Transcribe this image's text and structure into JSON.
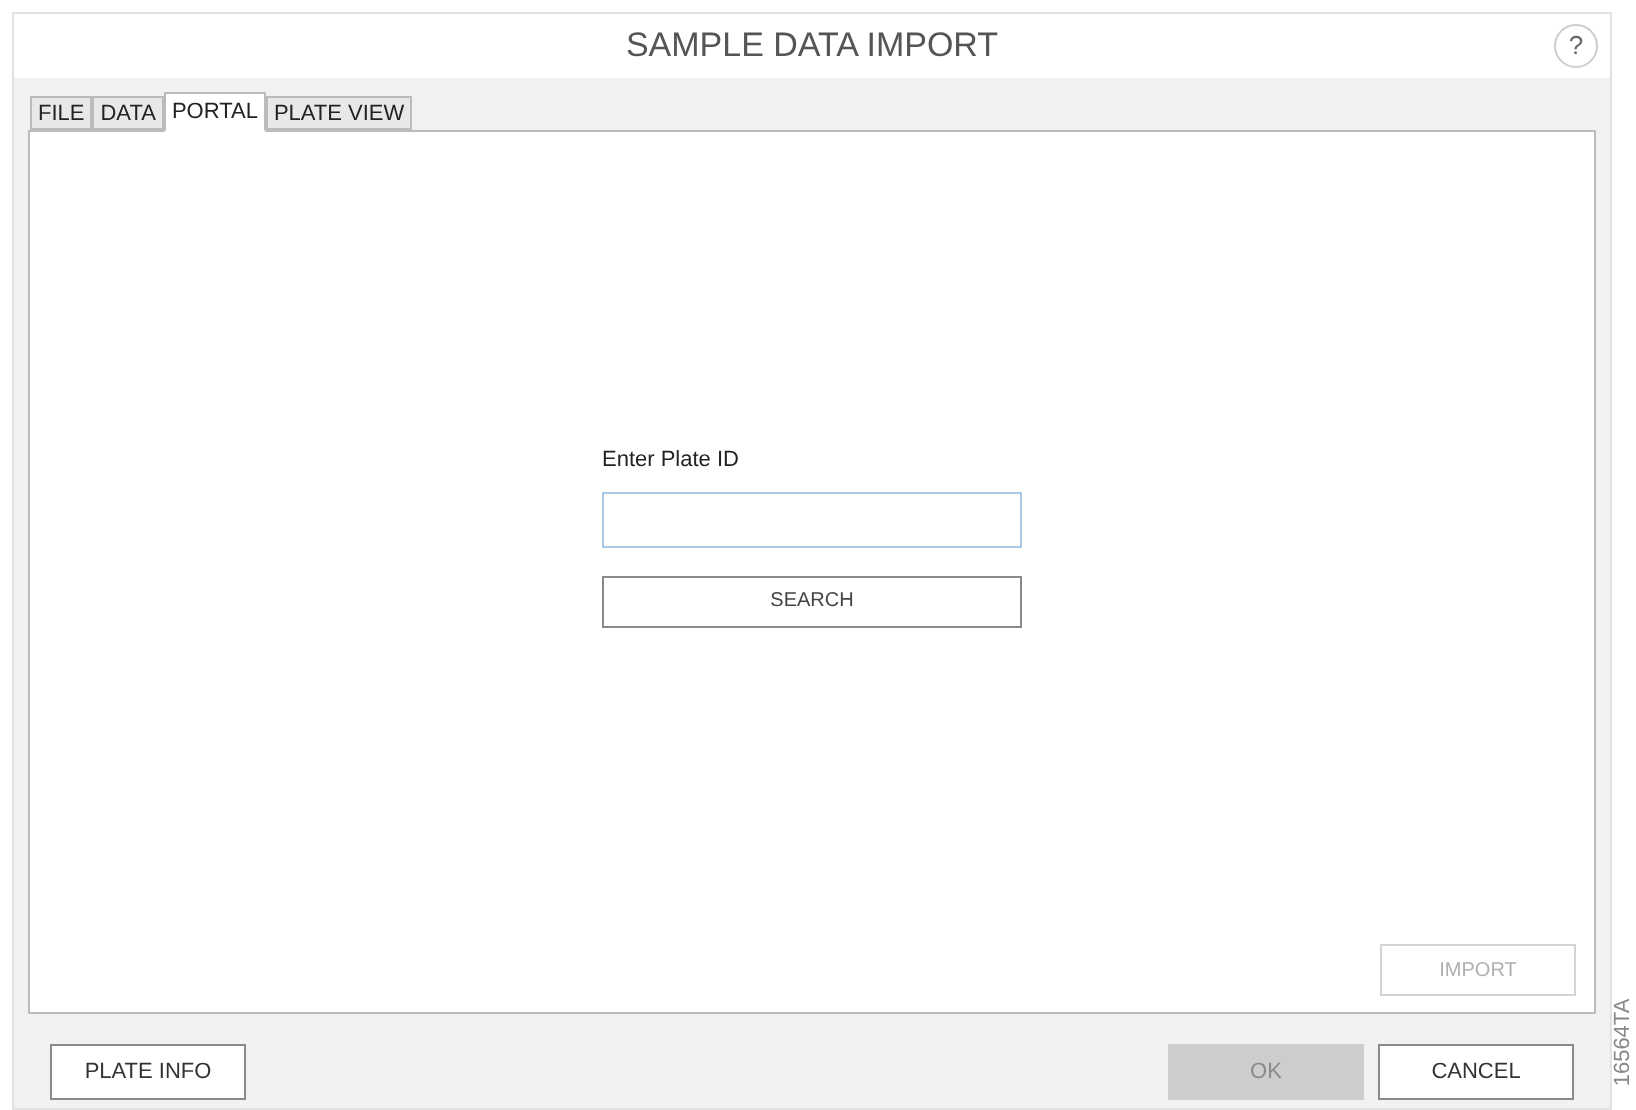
{
  "window": {
    "title": "SAMPLE DATA IMPORT",
    "help": "?"
  },
  "tabs": [
    {
      "label": "FILE",
      "selected": false
    },
    {
      "label": "DATA",
      "selected": false
    },
    {
      "label": "PORTAL",
      "selected": true
    },
    {
      "label": "PLATE VIEW",
      "selected": false
    }
  ],
  "portal": {
    "field_label": "Enter Plate ID",
    "search_button": "SEARCH",
    "import_button": {
      "label": "IMPORT",
      "disabled": true
    }
  },
  "footer": {
    "left_button": {
      "label": "PLATE INFO",
      "disabled": false
    },
    "right_buttons": [
      {
        "label": "OK",
        "disabled": true
      },
      {
        "label": "CANCEL",
        "disabled": false
      }
    ]
  },
  "figure_id": "16564TA"
}
